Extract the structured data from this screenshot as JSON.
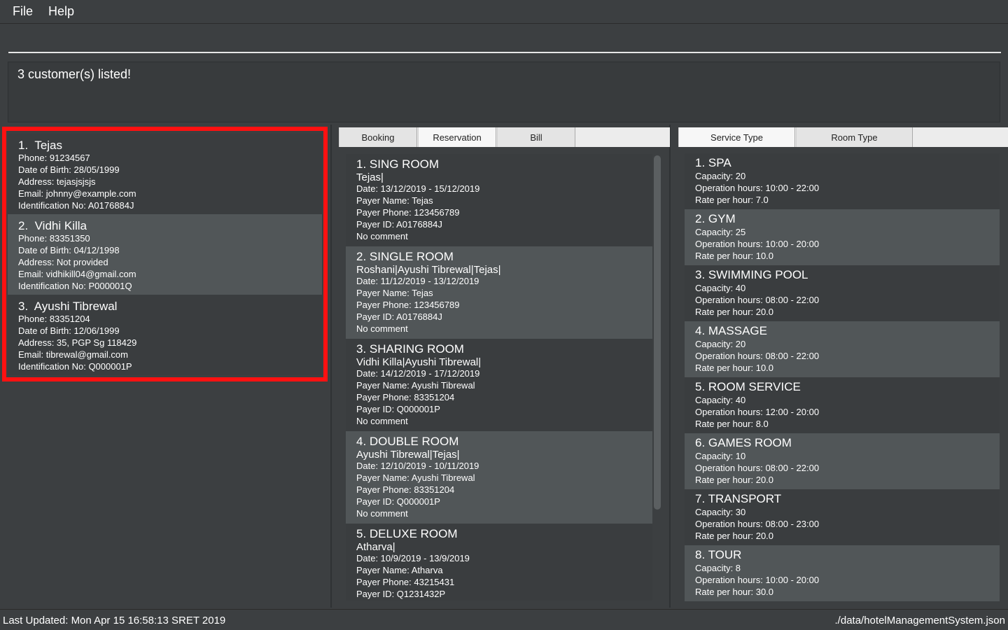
{
  "menu": {
    "file": "File",
    "help": "Help"
  },
  "command": {
    "value": "",
    "placeholder": ""
  },
  "result": {
    "text": "3 customer(s) listed!"
  },
  "customers": [
    {
      "index": "1.",
      "name": "Tejas",
      "phone": "Phone: 91234567",
      "dob": "Date of Birth: 28/05/1999",
      "address": "Address: tejasjsjsjs",
      "email": "Email: johnny@example.com",
      "id": "Identification No: A0176884J"
    },
    {
      "index": "2.",
      "name": "Vidhi Killa",
      "phone": "Phone: 83351350",
      "dob": "Date of Birth: 04/12/1998",
      "address": "Address: Not provided",
      "email": "Email: vidhikill04@gmail.com",
      "id": "Identification No: P000001Q"
    },
    {
      "index": "3.",
      "name": "Ayushi Tibrewal",
      "phone": "Phone: 83351204",
      "dob": "Date of Birth: 12/06/1999",
      "address": "Address: 35, PGP Sg 118429",
      "email": "Email: tibrewal@gmail.com",
      "id": "Identification No: Q000001P"
    }
  ],
  "middle_tabs": [
    "Booking",
    "Reservation",
    "Bill"
  ],
  "reservations": [
    {
      "title": "1.  SING ROOM",
      "names": "Tejas|",
      "date": "Date: 13/12/2019 - 15/12/2019",
      "payer_name": "Payer Name: Tejas",
      "payer_phone": "Payer Phone: 123456789",
      "payer_id": "Payer ID: A0176884J",
      "comment": "No comment"
    },
    {
      "title": "2.  SINGLE ROOM",
      "names": "Roshani|Ayushi Tibrewal|Tejas|",
      "date": "Date: 11/12/2019 - 13/12/2019",
      "payer_name": "Payer Name: Tejas",
      "payer_phone": "Payer Phone: 123456789",
      "payer_id": "Payer ID: A0176884J",
      "comment": "No comment"
    },
    {
      "title": "3.  SHARING ROOM",
      "names": "Vidhi Killa|Ayushi Tibrewal|",
      "date": "Date: 14/12/2019 - 17/12/2019",
      "payer_name": "Payer Name: Ayushi Tibrewal",
      "payer_phone": "Payer Phone: 83351204",
      "payer_id": "Payer ID: Q000001P",
      "comment": "No comment"
    },
    {
      "title": "4.  DOUBLE ROOM",
      "names": "Ayushi Tibrewal|Tejas|",
      "date": "Date: 12/10/2019 - 10/11/2019",
      "payer_name": "Payer Name: Ayushi Tibrewal",
      "payer_phone": "Payer Phone: 83351204",
      "payer_id": "Payer ID: Q000001P",
      "comment": "No comment"
    },
    {
      "title": "5.  DELUXE ROOM",
      "names": "Atharva|",
      "date": "Date: 10/9/2019 - 13/9/2019",
      "payer_name": "Payer Name: Atharva",
      "payer_phone": "Payer Phone: 43215431",
      "payer_id": "Payer ID: Q1231432P",
      "comment": ""
    }
  ],
  "right_tabs": [
    "Service Type",
    "Room Type"
  ],
  "services": [
    {
      "title": "1.  SPA",
      "capacity": "Capacity: 20",
      "hours": "Operation hours: 10:00 - 22:00",
      "rate": "Rate per hour: 7.0"
    },
    {
      "title": "2.  GYM",
      "capacity": "Capacity: 25",
      "hours": "Operation hours: 10:00 - 20:00",
      "rate": "Rate per hour: 10.0"
    },
    {
      "title": "3.  SWIMMING POOL",
      "capacity": "Capacity: 40",
      "hours": "Operation hours: 08:00 - 22:00",
      "rate": "Rate per hour: 20.0"
    },
    {
      "title": "4.  MASSAGE",
      "capacity": "Capacity: 20",
      "hours": "Operation hours: 08:00 - 22:00",
      "rate": "Rate per hour: 10.0"
    },
    {
      "title": "5.  ROOM SERVICE",
      "capacity": "Capacity: 40",
      "hours": "Operation hours: 12:00 - 20:00",
      "rate": "Rate per hour: 8.0"
    },
    {
      "title": "6.  GAMES ROOM",
      "capacity": "Capacity: 10",
      "hours": "Operation hours: 08:00 - 22:00",
      "rate": "Rate per hour: 20.0"
    },
    {
      "title": "7.  TRANSPORT",
      "capacity": "Capacity: 30",
      "hours": "Operation hours: 08:00 - 23:00",
      "rate": "Rate per hour: 20.0"
    },
    {
      "title": "8.  TOUR",
      "capacity": "Capacity: 8",
      "hours": "Operation hours: 10:00 - 20:00",
      "rate": "Rate per hour: 30.0"
    }
  ],
  "status": {
    "last_updated": "Last Updated: Mon Apr 15 16:58:13 SRET 2019",
    "file_path": "./data/hotelManagementSystem.json"
  },
  "colors": {
    "highlight_border": "#ff1111",
    "card_dark": "#3a3d3f",
    "card_light": "#515658",
    "background": "#3c3f41"
  }
}
